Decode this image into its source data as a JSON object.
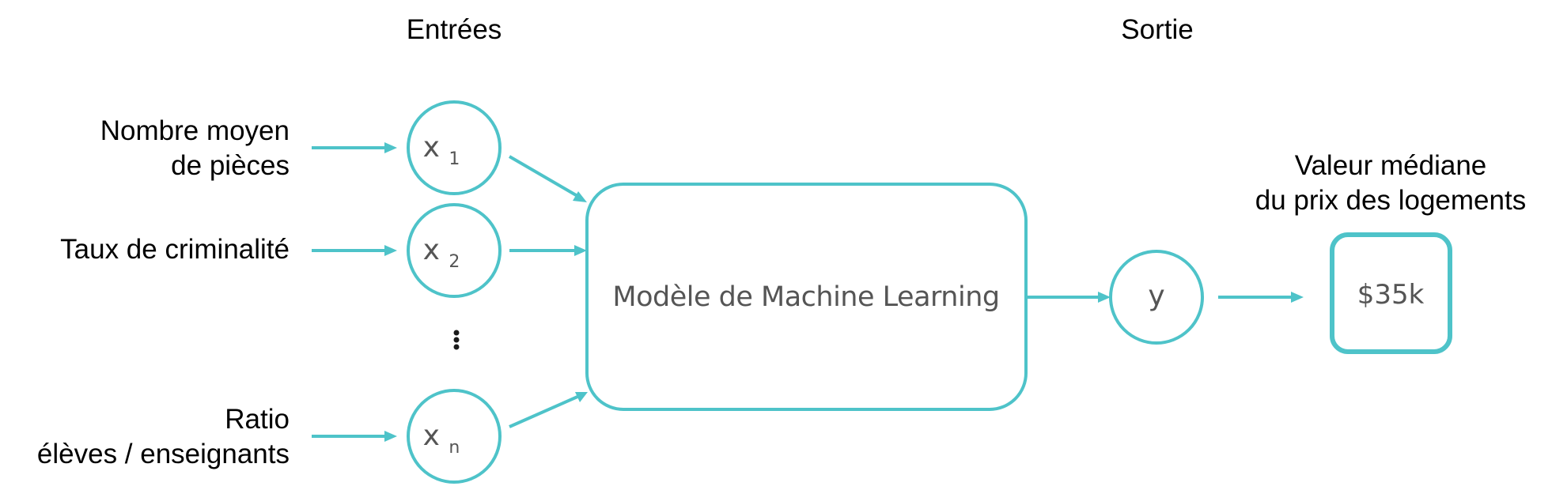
{
  "headers": {
    "inputs": "Entrées",
    "output": "Sortie"
  },
  "features": [
    {
      "line1": "Nombre moyen",
      "line2": "de pièces"
    },
    {
      "line1": "Taux de criminalité",
      "line2": ""
    },
    {
      "line1": "Ratio",
      "line2": "élèves / enseignants"
    }
  ],
  "nodes": {
    "x1_base": "x",
    "x1_sub": "1",
    "x2_base": "x",
    "x2_sub": "2",
    "xn_base": "x",
    "xn_sub": "n",
    "ellipsis": "⋮",
    "y": "y"
  },
  "model": {
    "label": "Modèle de Machine Learning"
  },
  "output": {
    "caption_line1": "Valeur médiane",
    "caption_line2": "du prix des logements",
    "value": "$35k"
  },
  "colors": {
    "accent": "#4ec3c9",
    "text": "#000000",
    "node_text": "#555555"
  }
}
